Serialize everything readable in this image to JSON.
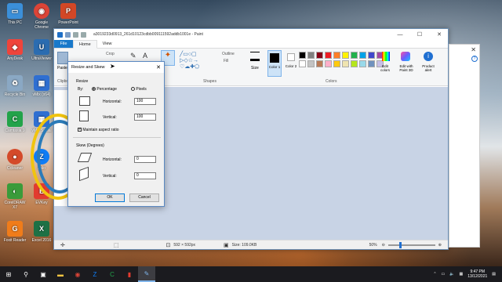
{
  "desktop": {
    "icons": [
      {
        "label": "This PC",
        "color": "#3b8fd9",
        "glyph": "▭"
      },
      {
        "label": "Google Chrome",
        "color": "#db4437",
        "glyph": "◉"
      },
      {
        "label": "PowerPoint",
        "color": "#d24726",
        "glyph": "P"
      },
      {
        "label": "AnyDesk",
        "color": "#ef443b",
        "glyph": "◆"
      },
      {
        "label": "UltraViewer",
        "color": "#2b6cb0",
        "glyph": "U"
      },
      {
        "label": "Recycle Bin",
        "color": "#8aa8c4",
        "glyph": "♻"
      },
      {
        "label": "vMix (x64)",
        "color": "#2f6fd1",
        "glyph": "▦"
      },
      {
        "label": "Camtasia 9",
        "color": "#22a34a",
        "glyph": "C"
      },
      {
        "label": "vMix Social",
        "color": "#2f6fd1",
        "glyph": "▦"
      },
      {
        "label": "Ccleaner",
        "color": "#d44a2a",
        "glyph": "●"
      },
      {
        "label": "Zalo",
        "color": "#0f7cf5",
        "glyph": "Z"
      },
      {
        "label": "CorelDRAW X7",
        "color": "#3a9b3a",
        "glyph": "◐"
      },
      {
        "label": "EVKey",
        "color": "#e23b2f",
        "glyph": "E"
      },
      {
        "label": "Foxit Reader",
        "color": "#f07c1a",
        "glyph": "G"
      },
      {
        "label": "Excel 2016",
        "color": "#1e7145",
        "glyph": "X"
      }
    ]
  },
  "paint": {
    "title": "a3019233d0913_261d10123cdbb009111592addb1001e - Paint",
    "menu": {
      "file": "File",
      "home": "Home",
      "view": "View"
    },
    "ribbon": {
      "paste": "Paste",
      "clipboard": "Clipboard",
      "crop": "Crop",
      "outline": "Outline",
      "fill": "Fill",
      "shapes": "Shapes",
      "size": "Size",
      "color1": "Color 1",
      "color2": "Color 2",
      "colors": "Colors",
      "edit_colors": "Edit colors",
      "edit_paint3d": "Edit with Paint 3D",
      "product_alert": "Product alert"
    },
    "palette": [
      "#000000",
      "#7f7f7f",
      "#880015",
      "#ed1c24",
      "#ff7f27",
      "#fff200",
      "#22b14c",
      "#00a2e8",
      "#3f48cc",
      "#a349a4",
      "#ffffff",
      "#c3c3c3",
      "#b97a57",
      "#ffaec9",
      "#ffc90e",
      "#efe4b0",
      "#b5e61d",
      "#99d9ea",
      "#7092be",
      "#c8bfe7"
    ],
    "status": {
      "dimensions": "592 × 592px",
      "size": "Size: 109.0KB",
      "zoom": "50%"
    }
  },
  "dialog": {
    "title": "Resize and Skew",
    "resize_label": "Resize",
    "by_label": "By:",
    "percentage": "Percentage",
    "pixels": "Pixels",
    "horizontal_label": "Horizontal:",
    "vertical_label": "Vertical:",
    "resize_horizontal": "100",
    "resize_vertical": "100",
    "maintain": "Maintain aspect ratio",
    "skew_label": "Skew (Degrees)",
    "skew_horizontal": "0",
    "skew_vertical": "0",
    "ok": "OK",
    "cancel": "Cancel"
  },
  "taskbar": {
    "time": "9:47 PM",
    "date": "13/12/2021"
  }
}
